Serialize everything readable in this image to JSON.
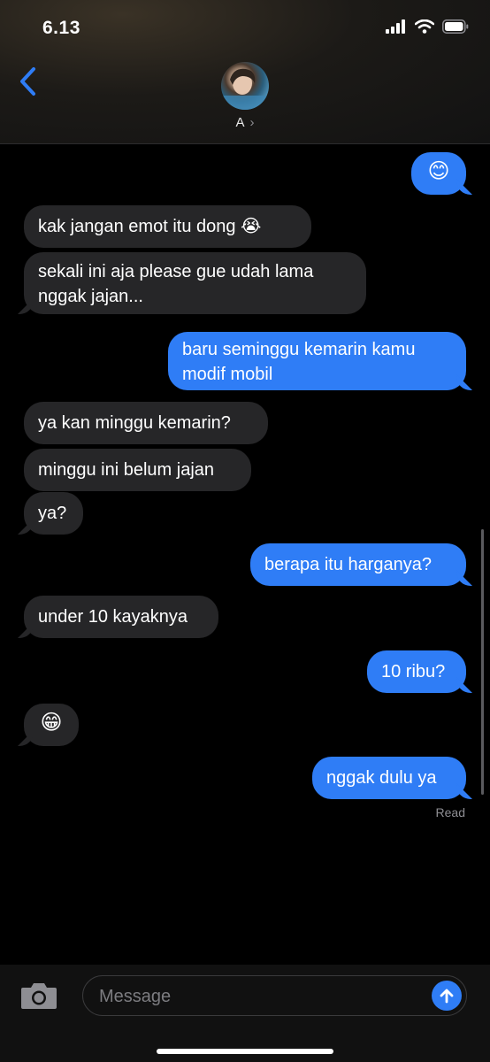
{
  "status_bar": {
    "time": "6.13",
    "icons": [
      "signal-icon",
      "wifi-icon",
      "battery-icon"
    ]
  },
  "header": {
    "contact_name": "A",
    "chevron": "›"
  },
  "messages": [
    {
      "dir": "out",
      "text": "😊"
    },
    {
      "dir": "in",
      "text": "kak jangan emot itu dong 😭"
    },
    {
      "dir": "in",
      "text": "sekali ini aja please gue udah lama nggak jajan..."
    },
    {
      "dir": "out",
      "text": "baru seminggu kemarin kamu modif mobil"
    },
    {
      "dir": "in",
      "text": "ya kan minggu kemarin?"
    },
    {
      "dir": "in",
      "text": "minggu ini belum jajan"
    },
    {
      "dir": "in",
      "text": "ya?"
    },
    {
      "dir": "out",
      "text": "berapa itu harganya?"
    },
    {
      "dir": "in",
      "text": "under 10 kayaknya"
    },
    {
      "dir": "out",
      "text": "10 ribu?"
    },
    {
      "dir": "in",
      "text": "😁"
    },
    {
      "dir": "out",
      "text": "nggak dulu ya"
    }
  ],
  "read_receipt": "Read",
  "composer": {
    "placeholder": "Message"
  },
  "colors": {
    "bubble_in": "#262628",
    "bubble_out": "#2f7df6",
    "accent": "#2f7df6"
  }
}
